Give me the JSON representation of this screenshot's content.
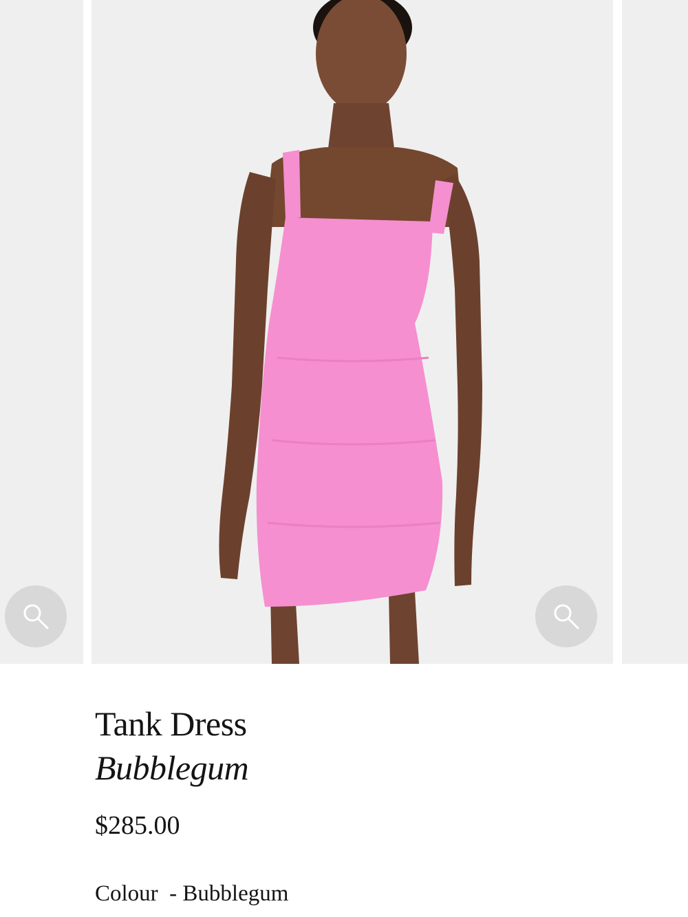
{
  "product": {
    "name": "Tank Dress",
    "variant": "Bubblegum",
    "price": "$285.00",
    "colour_label": "Colour",
    "colour_separator": "  - ",
    "colour_value": "Bubblegum"
  },
  "gallery": {
    "zoom_icon": "magnifier-icon",
    "dress_color": "#f58fcf",
    "background_color": "#efefef"
  }
}
